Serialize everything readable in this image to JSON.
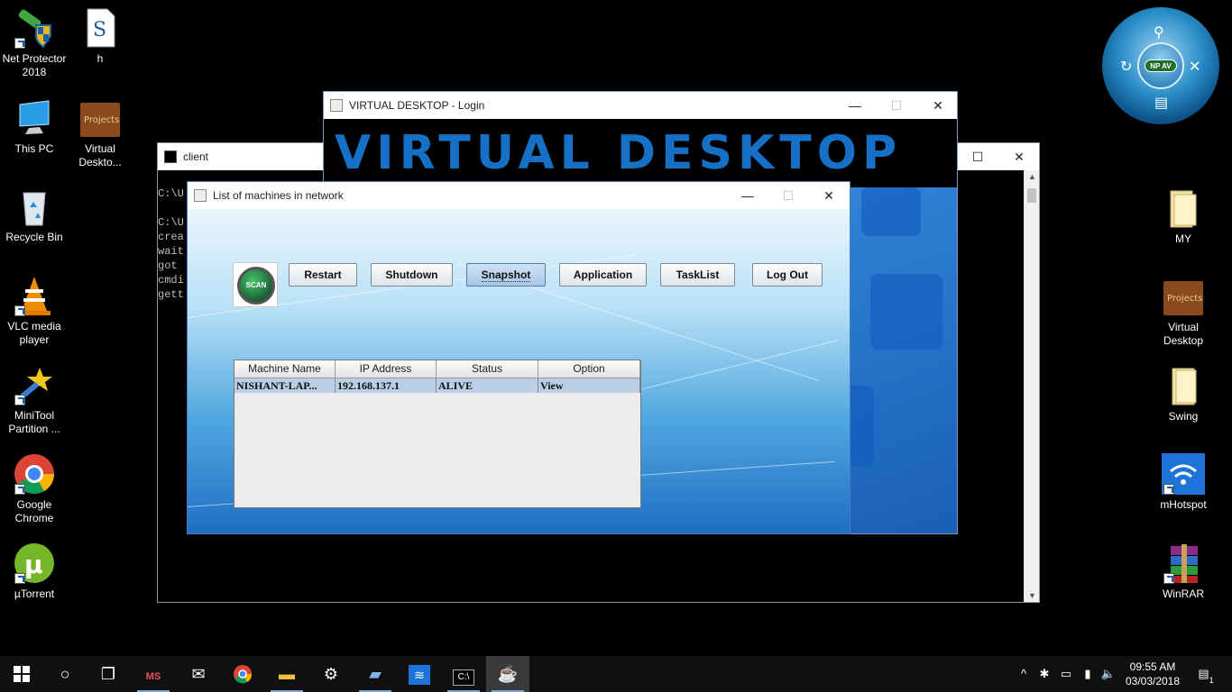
{
  "desktop_left": [
    {
      "label": "Net Protector 2018",
      "icon": "shield-icon"
    },
    {
      "label": "h",
      "icon": "script-file-icon"
    },
    {
      "label": "This PC",
      "icon": "computer-icon"
    },
    {
      "label": "Virtual Deskto...",
      "icon": "projects-folder-icon",
      "badge": "Projects"
    },
    {
      "label": "Recycle Bin",
      "icon": "recycle-bin-icon"
    },
    {
      "label": "VLC media player",
      "icon": "vlc-cone-icon"
    },
    {
      "label": "MiniTool Partition ...",
      "icon": "minitool-wand-icon"
    },
    {
      "label": "Google Chrome",
      "icon": "chrome-icon"
    },
    {
      "label": "µTorrent",
      "icon": "utorrent-icon"
    }
  ],
  "desktop_right": [
    {
      "label": "MY",
      "icon": "folder-icon"
    },
    {
      "label": "Virtual Desktop",
      "icon": "projects-folder-icon",
      "badge": "Projects"
    },
    {
      "label": "Swing",
      "icon": "folder-icon"
    },
    {
      "label": "mHotspot",
      "icon": "wifi-icon"
    },
    {
      "label": "WinRAR",
      "icon": "winrar-icon"
    }
  ],
  "gadget": {
    "badge": "NP AV"
  },
  "console": {
    "title": "client",
    "lines": [
      "C:\\U",
      "",
      "C:\\U",
      "crea",
      "wait",
      "got",
      "cmdi",
      "gett"
    ]
  },
  "login": {
    "title": "VIRTUAL DESKTOP - Login",
    "banner": "VIRTUAL DESKTOP"
  },
  "list_window": {
    "title": "List of machines in network",
    "scan_label": "SCAN",
    "buttons": [
      "Restart",
      "Shutdown",
      "Snapshot",
      "Application",
      "TaskList",
      "Log Out"
    ],
    "active_button": "Snapshot",
    "table": {
      "headers": [
        "Machine Name",
        "IP Address",
        "Status",
        "Option"
      ],
      "rows": [
        [
          "NISHANT-LAP...",
          "192.168.137.1",
          "ALIVE",
          "View"
        ]
      ]
    }
  },
  "taskbar": {
    "items": [
      "windows-start-icon",
      "cortana-search-icon",
      "task-view-icon",
      "ms-dos-app-icon",
      "mail-icon",
      "chrome-icon",
      "file-explorer-icon",
      "settings-gear-icon",
      "document-app-icon",
      "wifi-hotspot-icon",
      "command-prompt-icon",
      "java-app-icon"
    ],
    "time": "09:55 AM",
    "date": "03/03/2018",
    "notification_count": "1"
  },
  "colors": {
    "banner_text": "#1570c6",
    "desktop_bg": "#000000",
    "taskbar_bg": "#101010"
  }
}
